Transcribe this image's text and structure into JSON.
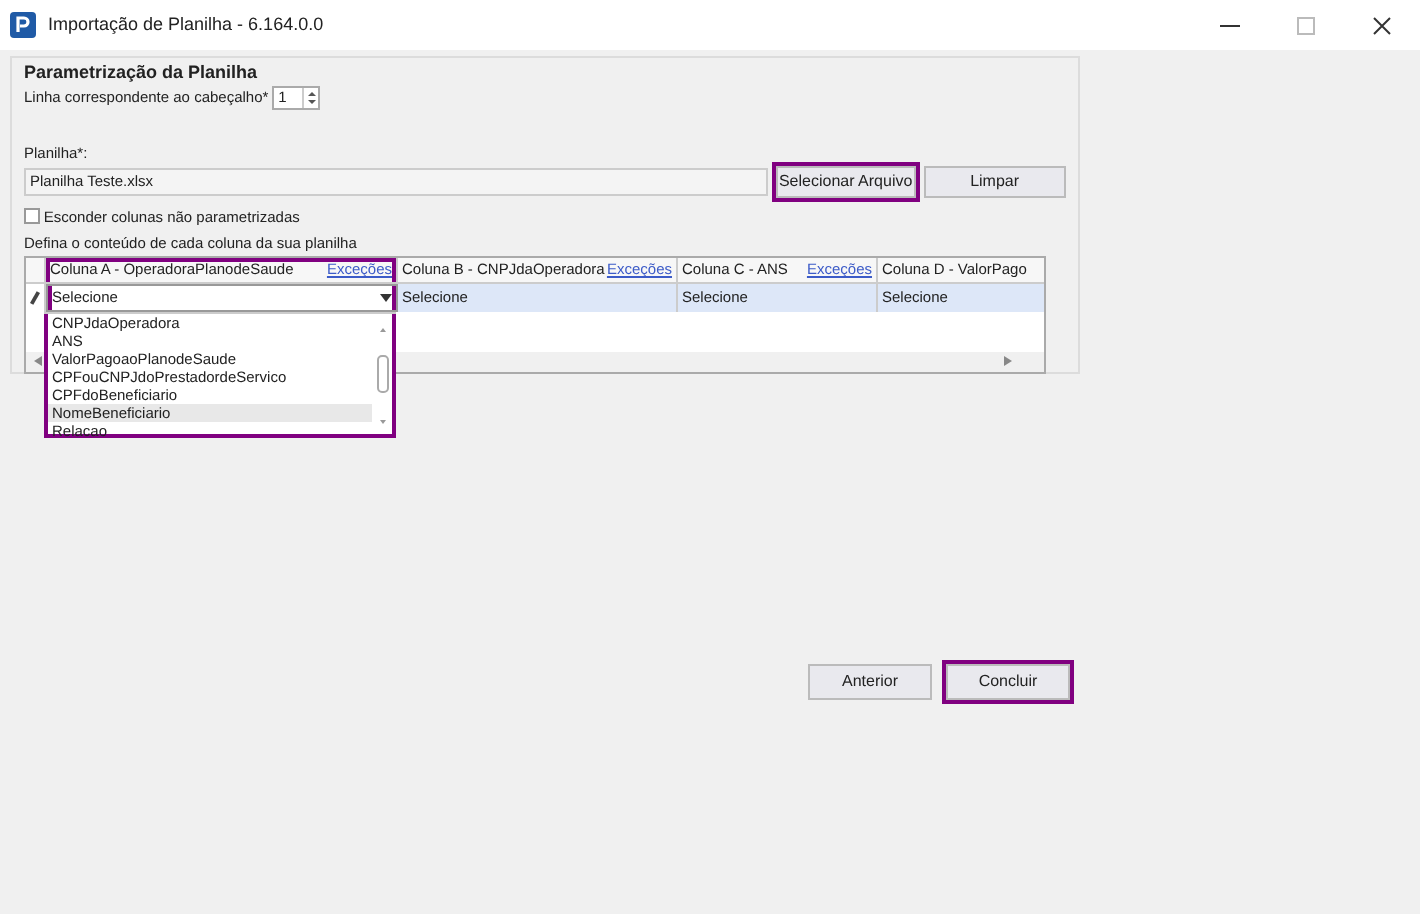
{
  "window": {
    "title": "Importação de Planilha - 6.164.0.0"
  },
  "panel": {
    "title": "Parametrização da Planilha",
    "header_row": {
      "label": "Linha correspondente ao cabeçalho*",
      "value": "1"
    },
    "file": {
      "label": "Planilha*:",
      "value": "Planilha Teste.xlsx"
    },
    "buttons": [
      {
        "label": "Selecionar Arquivo",
        "highlighted": true
      },
      {
        "label": "Limpar",
        "highlighted": false
      }
    ],
    "hide_columns": {
      "label": "Esconder colunas não parametrizadas",
      "checked": false
    },
    "grid_label": "Defina o conteúdo de cada coluna da sua planilha",
    "columns": [
      {
        "header": "Coluna A - OperadoraPlanodeSaude",
        "link": "Exceções",
        "value": "Selecione",
        "open": true,
        "highlighted": true,
        "options": [
          {
            "label": "CNPJdaOperadora",
            "hovered": false
          },
          {
            "label": "ANS",
            "hovered": false
          },
          {
            "label": "ValorPagoaoPlanodeSaude",
            "hovered": false
          },
          {
            "label": "CPFouCNPJdoPrestadordeServico",
            "hovered": false
          },
          {
            "label": "CPFdoBeneficiario",
            "hovered": false
          },
          {
            "label": "NomeBeneficiario",
            "hovered": true
          },
          {
            "label": "Relacao",
            "hovered": false
          }
        ]
      },
      {
        "header": "Coluna B - CNPJdaOperadora",
        "link": "Exceções",
        "value": "Selecione",
        "open": false,
        "highlighted": false
      },
      {
        "header": "Coluna C - ANS",
        "link": "Exceções",
        "value": "Selecione",
        "open": false,
        "highlighted": false
      },
      {
        "header": "Coluna D - ValorPago",
        "value": "Selecione",
        "open": false,
        "highlighted": false
      }
    ]
  },
  "footer_buttons": [
    {
      "label": "Anterior",
      "highlighted": false
    },
    {
      "label": "Concluir",
      "highlighted": true
    }
  ]
}
